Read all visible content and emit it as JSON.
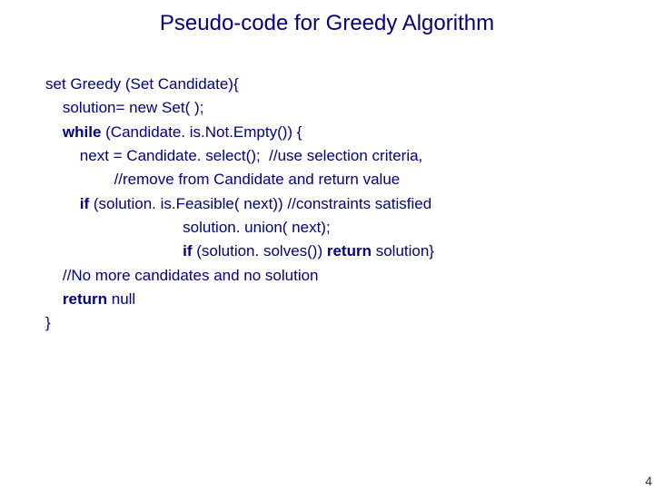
{
  "title": "Pseudo-code for Greedy Algorithm",
  "code": {
    "l1_a": "set Greedy (Set Candidate){",
    "l2_a": "    solution= new Set( );",
    "l3_kw": "    while",
    "l3_rest": " (Candidate. is.Not.Empty()) {",
    "l4_a": "        next = Candidate. select();  //use selection criteria,",
    "l5_a": "                //remove from Candidate and return value",
    "l6_kw": "        if",
    "l6_rest": " (solution. is.Feasible( next)) //constraints satisfied",
    "l7_a": "                                solution. union( next);",
    "l8_kw1": "                                if",
    "l8_mid": " (solution. solves()) ",
    "l8_kw2": "return",
    "l8_end": " solution}",
    "l9_a": "    //No more candidates and no solution",
    "l10_kw": "    return",
    "l10_rest": " null",
    "l11_a": "}"
  },
  "page_number": "4"
}
